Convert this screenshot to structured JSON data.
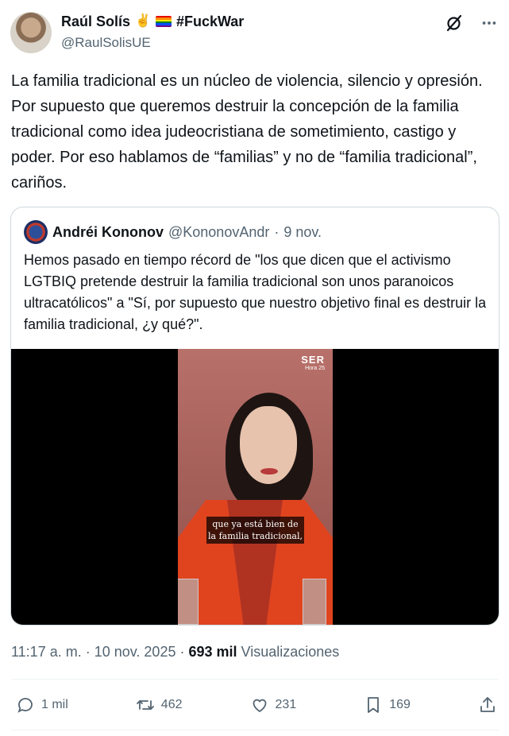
{
  "author": {
    "display_name": "Raúl Solís",
    "name_emoji": "✌️",
    "flag": "rainbow-flag",
    "hashtag": "#FuckWar",
    "handle": "@RaulSolisUE"
  },
  "top_icons": [
    "grok-icon",
    "more-icon"
  ],
  "tweet_text": "La familia tradicional es un núcleo de violencia, silencio y opresión. Por supuesto que queremos destruir la concepción de la familia tradicional como idea judeocristiana de sometimiento, castigo y poder. Por eso hablamos de “familias” y no de “familia tradicional”, cariños.",
  "quoted_tweet": {
    "display_name": "Andréi Kononov",
    "handle": "@KononovAndr",
    "separator": "·",
    "date": "9 nov.",
    "text": "Hemos pasado en tiempo récord de \"los que dicen que el activismo LGTBIQ pretende destruir la familia tradicional son unos paranoicos ultracatólicos\" a \"Sí, por supuesto que nuestro objetivo final es destruir la familia tradicional, ¿y qué?\".",
    "video": {
      "logo": "SER",
      "logo_sub": "Hora 25",
      "subtitle_line1": "que ya está bien de",
      "subtitle_line2": "la familia tradicional,"
    }
  },
  "timestamp": "11:17 a. m. · 10 nov. 2025 ·",
  "views_count": "693 mil",
  "views_label": "Visualizaciones",
  "actions": {
    "replies": "1 mil",
    "reposts": "462",
    "likes": "231",
    "bookmarks": "169"
  },
  "colors": {
    "text": "#0f1419",
    "secondary": "#536471",
    "border": "#cfd9de",
    "jacket": "#e0441f"
  }
}
